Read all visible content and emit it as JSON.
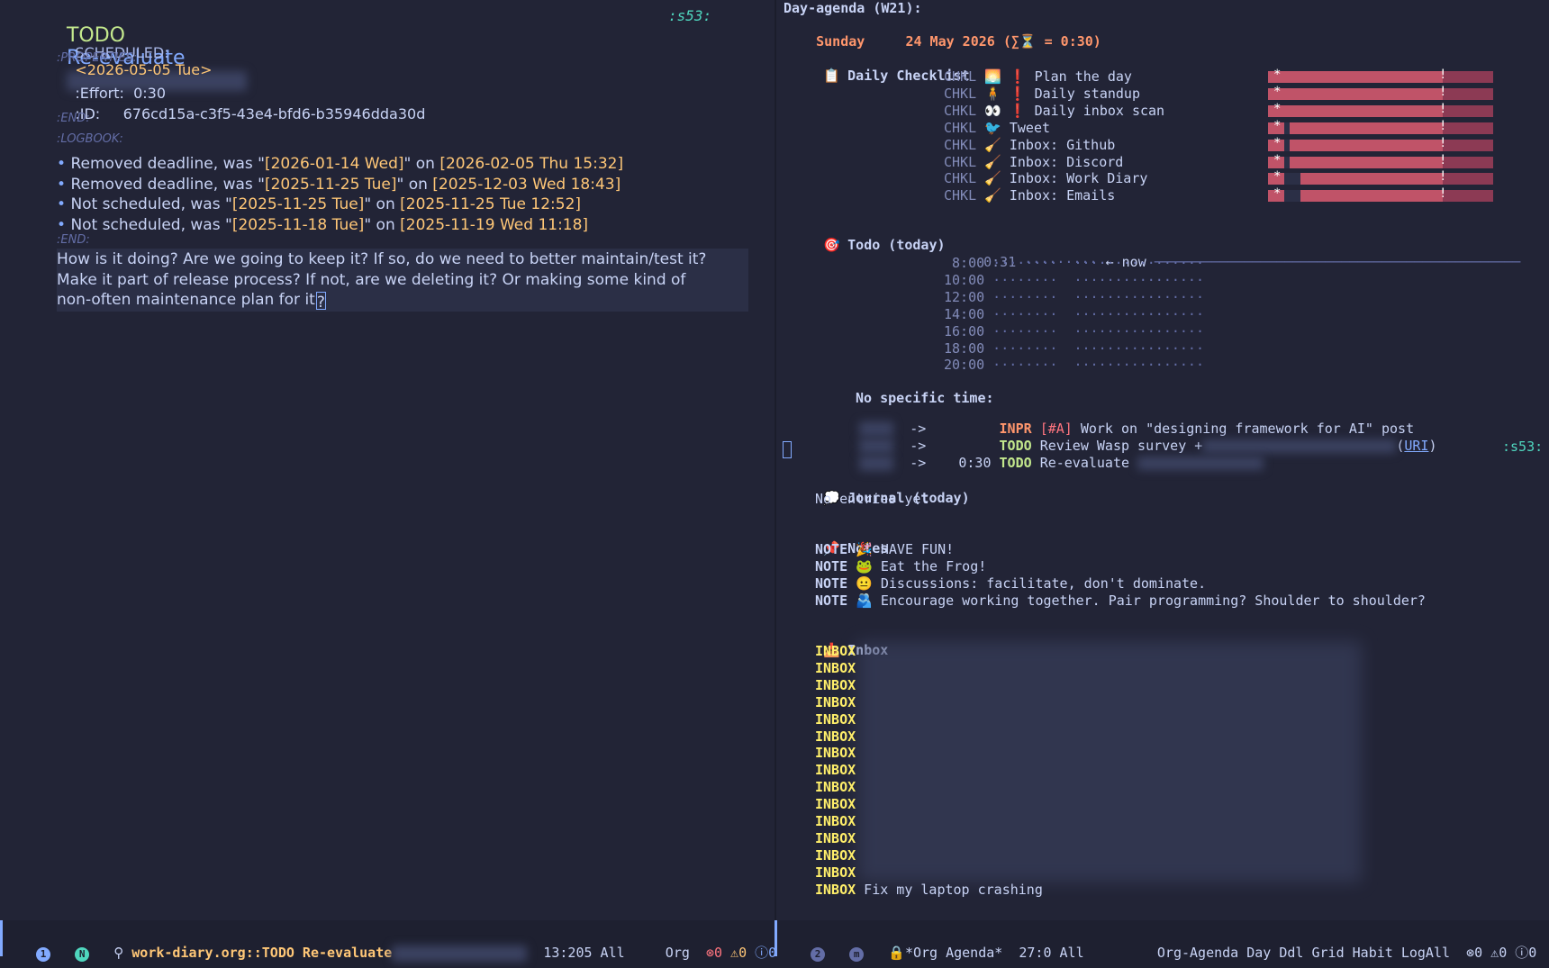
{
  "left": {
    "heading": {
      "keyword": "TODO",
      "title": "Re-evaluate"
    },
    "tag": ":s53:",
    "scheduled": {
      "label": "SCHEDULED:",
      "date": "<2026-05-05 Tue>"
    },
    "properties_open": ":PROPERTIES:",
    "effort": {
      "key": ":Effort:",
      "value": "0:30"
    },
    "id": {
      "key": ":ID:",
      "value": "676cd15a-c3f5-43e4-bfd6-b35946dda30d"
    },
    "end1": ":END:",
    "logbook_open": ":LOGBOOK:",
    "logbook": [
      {
        "text": "Removed deadline, was \"",
        "old": "[2026-01-14 Wed]",
        "mid": "\" on ",
        "at": "[2026-02-05 Thu 15:32]"
      },
      {
        "text": "Removed deadline, was \"",
        "old": "[2025-11-25 Tue]",
        "mid": "\" on ",
        "at": "[2025-12-03 Wed 18:43]"
      },
      {
        "text": "Not scheduled, was \"",
        "old": "[2025-11-25 Tue]",
        "mid": "\" on ",
        "at": "[2025-11-25 Tue 12:52]"
      },
      {
        "text": "Not scheduled, was \"",
        "old": "[2025-11-18 Tue]",
        "mid": "\" on ",
        "at": "[2025-11-19 Wed 11:18]"
      }
    ],
    "end2": ":END:",
    "body": [
      "How is it doing? Are we going to keep it? If so, do we need to better maintain/test it?",
      "Make it part of release process? If not, are we deleting it? Or making some kind of",
      "non-often maintenance plan for it"
    ],
    "body_cursor_char": "?"
  },
  "right": {
    "title": "Day-agenda (W21):",
    "day": "Sunday",
    "date": "24 May 2026",
    "total": "(∑⏳ = 0:30)",
    "checklist": {
      "heading": "Daily Checklist",
      "icon": "clipboard-icon",
      "items": [
        {
          "kw": "CHKL",
          "emoji": "🌅",
          "bang": "❗",
          "label": "Plan the day"
        },
        {
          "kw": "CHKL",
          "emoji": "🧍",
          "bang": "❗",
          "label": "Daily standup"
        },
        {
          "kw": "CHKL",
          "emoji": "👀",
          "bang": "❗",
          "label": "Daily inbox scan"
        },
        {
          "kw": "CHKL",
          "emoji": "🐦",
          "bang": "",
          "label": "Tweet"
        },
        {
          "kw": "CHKL",
          "emoji": "🧹",
          "bang": "",
          "label": "Inbox: Github"
        },
        {
          "kw": "CHKL",
          "emoji": "🧹",
          "bang": "",
          "label": "Inbox: Discord"
        },
        {
          "kw": "CHKL",
          "emoji": "🧹",
          "bang": "",
          "label": "Inbox: Work Diary"
        },
        {
          "kw": "CHKL",
          "emoji": "🧹",
          "bang": "",
          "label": "Inbox: Emails"
        }
      ],
      "habit_star": "*",
      "habit_bang": "!"
    },
    "todo": {
      "heading": "Todo (today)",
      "icon": "target-icon",
      "now_time": "0:31",
      "now_label": "← now",
      "grid_times": [
        "8:00",
        "10:00",
        "12:00",
        "14:00",
        "16:00",
        "18:00",
        "20:00"
      ],
      "no_time_label": "No specific time:",
      "items": [
        {
          "arrow": "->",
          "time": "",
          "kw": "INPR",
          "prio": "[#A]",
          "text": "Work on \"designing framework for AI\" post"
        },
        {
          "arrow": "->",
          "time": "",
          "kw": "TODO",
          "prio": "",
          "text": "Review Wasp survey +",
          "link": "URI"
        },
        {
          "arrow": "->",
          "time": "0:30",
          "kw": "TODO",
          "prio": "",
          "text": "Re-evaluate",
          "tag": ":s53:"
        }
      ]
    },
    "journal": {
      "heading": "Journal (today)",
      "icon": "speech-bubble-icon",
      "empty": "No entries yet"
    },
    "notes": {
      "heading": "Notes",
      "icon": "pushpin-icon",
      "items": [
        {
          "kw": "NOTE",
          "emoji": "🎉",
          "text": "HAVE FUN!"
        },
        {
          "kw": "NOTE",
          "emoji": "🐸",
          "text": "Eat the Frog!"
        },
        {
          "kw": "NOTE",
          "emoji": "😐",
          "text": "Discussions: facilitate, don't dominate."
        },
        {
          "kw": "NOTE",
          "emoji": "🫂",
          "text": "Encourage working together. Pair programming? Shoulder to shoulder?"
        }
      ]
    },
    "inbox": {
      "heading": "Inbox",
      "icon": "inbox-tray-icon",
      "kw": "INBOX",
      "hidden_count": 14,
      "last_item": "Fix my laptop crashing"
    }
  },
  "modeline_left": {
    "window_num": "1",
    "state": "N",
    "file": "work-diary.org::TODO Re-evaluate",
    "position": "13:205",
    "scope": "All",
    "mode": "Org",
    "errors": "0",
    "warnings": "0",
    "infos": "0"
  },
  "modeline_right": {
    "window_num": "2",
    "state": "m",
    "buffer": "*Org Agenda*",
    "position": "27:0",
    "scope": "All",
    "mode": "Org-Agenda Day Ddl Grid Habit LogAll",
    "errors": "0",
    "warnings": "0",
    "infos": "0"
  }
}
